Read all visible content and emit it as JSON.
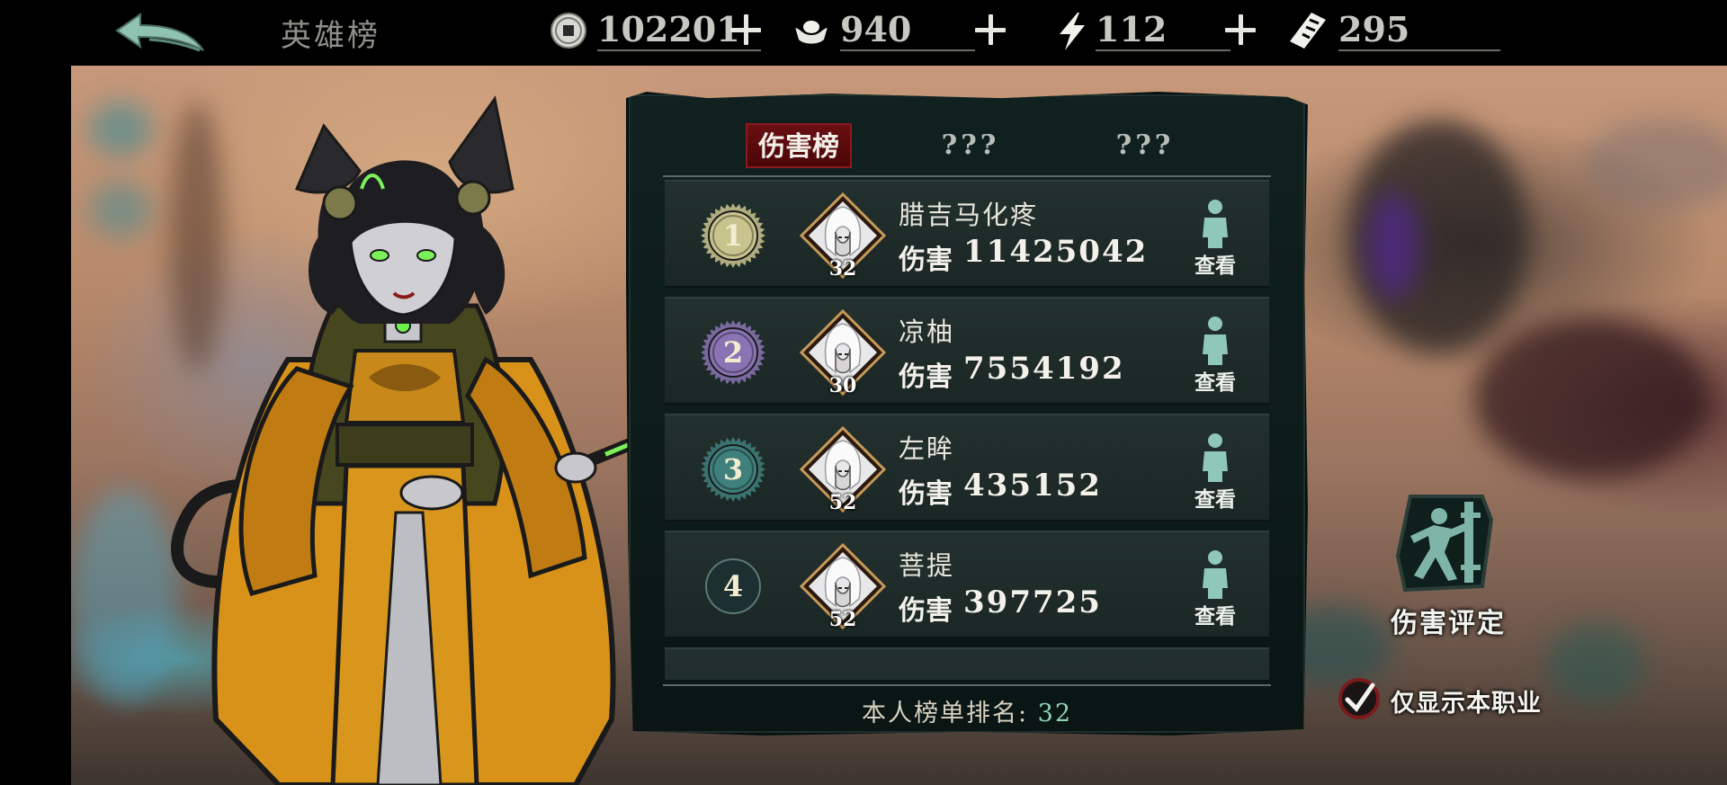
{
  "header": {
    "title": "英雄榜",
    "resources": [
      {
        "name": "copper-coin",
        "value": "102201"
      },
      {
        "name": "silver-ingot",
        "value": "940"
      },
      {
        "name": "stamina",
        "value": "112"
      },
      {
        "name": "talisman",
        "value": "295"
      }
    ]
  },
  "tabs": [
    {
      "label": "伤害榜",
      "active": true
    },
    {
      "label": "???",
      "active": false
    },
    {
      "label": "???",
      "active": false
    }
  ],
  "leaderboard": {
    "damage_label": "伤害",
    "view_label": "查看",
    "rows": [
      {
        "rank": "1",
        "name": "腊吉马化疼",
        "level": "32",
        "damage": "11425042",
        "badge_color": "#c9c48e"
      },
      {
        "rank": "2",
        "name": "凉柚",
        "level": "30",
        "damage": "7554192",
        "badge_color": "#8a74b4"
      },
      {
        "rank": "3",
        "name": "左眸",
        "level": "52",
        "damage": "435152",
        "badge_color": "#3f7f7c"
      },
      {
        "rank": "4",
        "name": "菩提",
        "level": "52",
        "damage": "397725",
        "badge_color": "#1c2f31"
      }
    ],
    "my_rank_label": "本人榜单排名:",
    "my_rank_value": "32"
  },
  "side": {
    "damage_eval_label": "伤害评定",
    "only_class_label": "仅显示本职业"
  },
  "colors": {
    "accent_red": "#6a0f12",
    "panel_bg": "#10211f",
    "rank_text_green": "#8fd3b3"
  }
}
